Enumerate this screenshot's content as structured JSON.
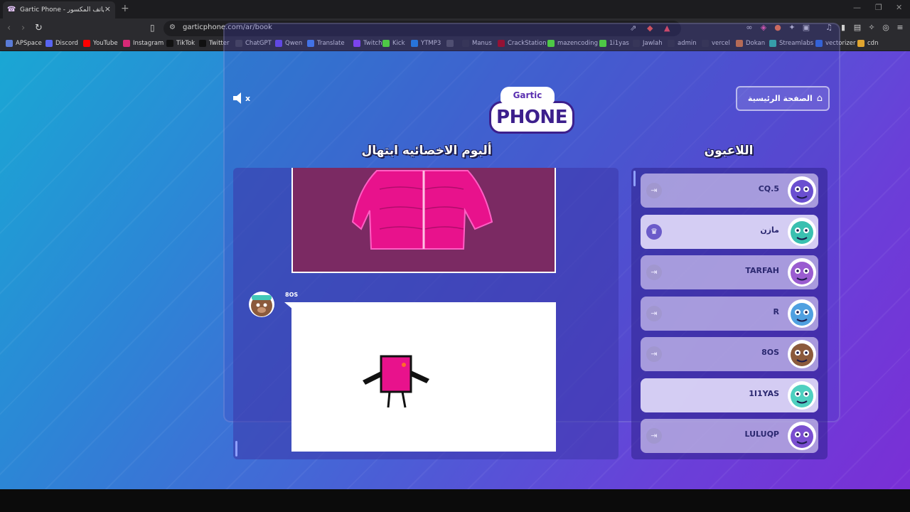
{
  "browser": {
    "tab_title": "Gartic Phone - لعبة الهاتف المكسور",
    "tab_favicon": "☎",
    "url": "garticphone.com/ar/book",
    "bookmarks": [
      {
        "label": "APSpace",
        "color": "#5a7bd6"
      },
      {
        "label": "Discord",
        "color": "#5865f2"
      },
      {
        "label": "YouTube",
        "color": "#ff0000"
      },
      {
        "label": "Instagram",
        "color": "#d62976"
      },
      {
        "label": "TikTok",
        "color": "#111111"
      },
      {
        "label": "Twitter",
        "color": "#111111"
      },
      {
        "label": "ChatGPT",
        "color": "#444444"
      },
      {
        "label": "Qwen",
        "color": "#6b4cf0"
      },
      {
        "label": "Translate",
        "color": "#4285f4"
      },
      {
        "label": "Twitch",
        "color": "#9146ff"
      },
      {
        "label": "Kick",
        "color": "#53fc18"
      },
      {
        "label": "YTMP3",
        "color": "#1e88e5"
      },
      {
        "label": "",
        "color": "#555555"
      },
      {
        "label": "Manus",
        "color": "#333333"
      },
      {
        "label": "CrackStation",
        "color": "#b30000"
      },
      {
        "label": "mazencoding",
        "color": "#53fc18"
      },
      {
        "label": "1i1yas",
        "color": "#53fc18"
      },
      {
        "label": "Jawlah",
        "color": "#333333"
      },
      {
        "label": "admin",
        "color": "#333333"
      },
      {
        "label": "vercel",
        "color": "#333333"
      },
      {
        "label": "Dokan",
        "color": "#e07a2f"
      },
      {
        "label": "Streamlabs",
        "color": "#31c3a2"
      },
      {
        "label": "vectorizer",
        "color": "#2f6fe0"
      },
      {
        "label": "cdn",
        "color": "#e0a52f"
      }
    ]
  },
  "game": {
    "logo_top": "Gartic",
    "logo_main": "PHONE",
    "mute_label": "x",
    "home_button": "الصفحة الرئيسية",
    "album_title": "ألبوم الاخصائيه ابتهال",
    "players_title": "اللاعبون",
    "entry_author": "8OS",
    "players": [
      {
        "name": "CQ.5",
        "avatar_color": "#6a4fd0",
        "action": "exit-icon"
      },
      {
        "name": "مازن",
        "avatar_color": "#3ac0b0",
        "action": "crown-icon"
      },
      {
        "name": "TARFAH",
        "avatar_color": "#9a5cd0",
        "action": "exit-icon"
      },
      {
        "name": "R",
        "avatar_color": "#4fa0e0",
        "action": "exit-icon"
      },
      {
        "name": "8OS",
        "avatar_color": "#8b5a3c",
        "action": "exit-icon"
      },
      {
        "name": "1I1YAS",
        "avatar_color": "#4fd0c0",
        "action": "none"
      },
      {
        "name": "LULUQP",
        "avatar_color": "#7a4fd0",
        "action": "exit-icon"
      }
    ]
  }
}
